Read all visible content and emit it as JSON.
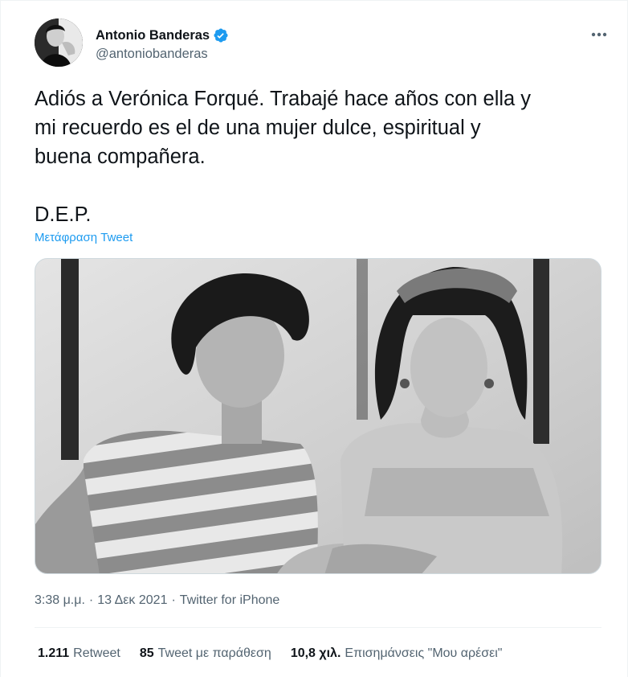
{
  "author": {
    "display_name": "Antonio Banderas",
    "handle": "@antoniobanderas",
    "verified": true,
    "avatar_icon": "profile-photo"
  },
  "tweet": {
    "text": "Adiós a Verónica Forqué. Trabajé hace años con ella y\nmi recuerdo es el de una mujer dulce, espiritual y\nbuena compañera.\n\nD.E.P.",
    "translate_label": "Μετάφραση Tweet"
  },
  "media": {
    "type": "black-and-white photo",
    "icon": "photo"
  },
  "meta": {
    "time": "3:38 μ.μ.",
    "separator1": "·",
    "date": "13 Δεκ 2021",
    "separator2": "·",
    "source": "Twitter for iPhone"
  },
  "stats": {
    "retweets": {
      "count": "1.211",
      "label": "Retweet"
    },
    "quotes": {
      "count": "85",
      "label": "Tweet με παράθεση"
    },
    "likes": {
      "count": "10,8 χιλ.",
      "label": "Επισημάνσεις \"Μου αρέσει\""
    }
  },
  "colors": {
    "accent": "#1d9bf0",
    "text_primary": "#0f1419",
    "text_secondary": "#536471",
    "border": "#eff3f4"
  }
}
